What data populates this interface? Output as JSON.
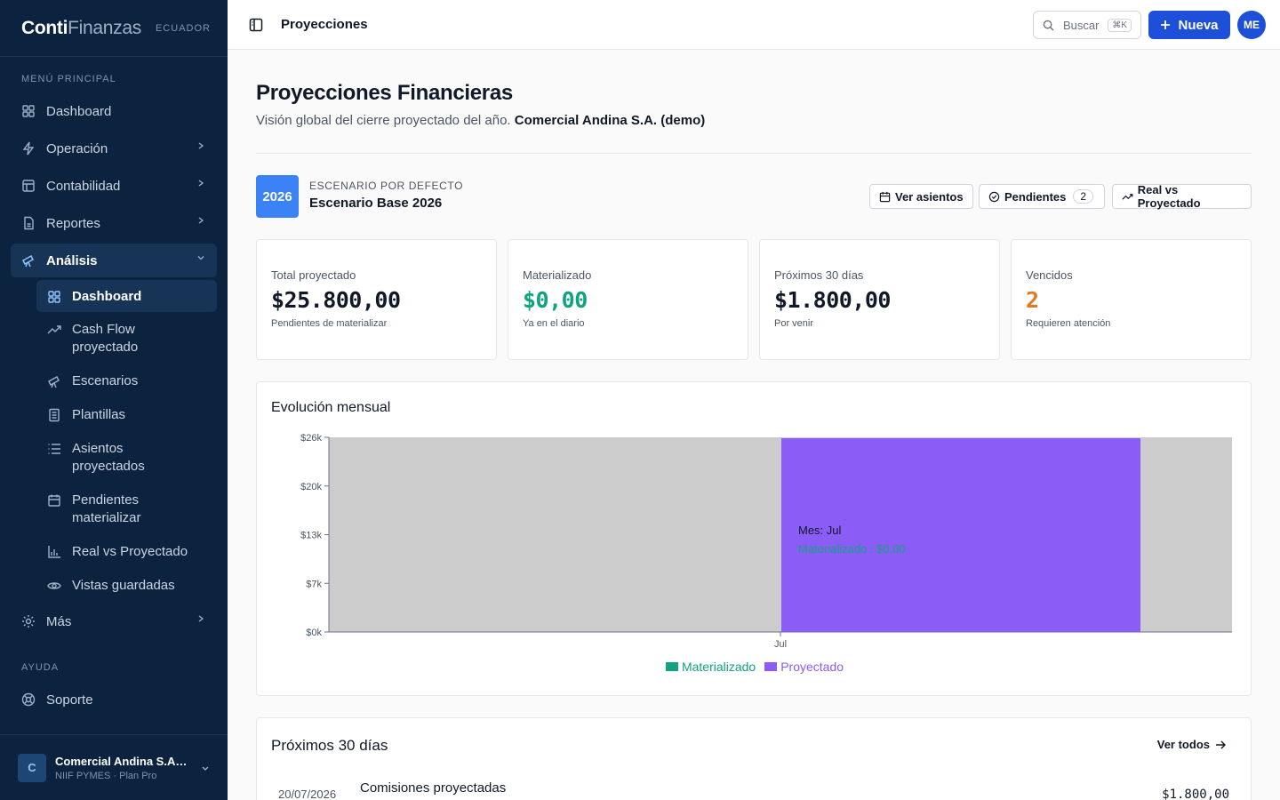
{
  "brand": {
    "name_a": "Conti",
    "name_b": "Finanzas",
    "country": "ECUADOR"
  },
  "sidebar": {
    "section_main": "MENÚ PRINCIPAL",
    "items": [
      {
        "label": "Dashboard",
        "icon": "grid-icon"
      },
      {
        "label": "Operación",
        "icon": "bolt-icon"
      },
      {
        "label": "Contabilidad",
        "icon": "grid-icon"
      },
      {
        "label": "Reportes",
        "icon": "file-icon"
      },
      {
        "label": "Análisis",
        "icon": "telescope-icon"
      }
    ],
    "sub_items": [
      {
        "label": "Dashboard"
      },
      {
        "label": "Cash Flow proyectado"
      },
      {
        "label": "Escenarios"
      },
      {
        "label": "Plantillas"
      },
      {
        "label": "Asientos proyectados"
      },
      {
        "label": "Pendientes materializar"
      },
      {
        "label": "Real vs Proyectado"
      },
      {
        "label": "Vistas guardadas"
      }
    ],
    "more": "Más",
    "section_help": "AYUDA",
    "support": "Soporte",
    "org_initial": "C",
    "org_name": "Comercial Andina S.A. (demo)",
    "org_plan": "NIIF PYMES · Plan Pro"
  },
  "header": {
    "title": "Proyecciones",
    "search_label": "Buscar",
    "search_kbd": "⌘K",
    "new_label": "Nueva",
    "user_initials": "ME"
  },
  "page": {
    "title": "Proyecciones Financieras",
    "subtitle": "Visión global del cierre proyectado del año.",
    "company": "Comercial Andina S.A. (demo)"
  },
  "scenario": {
    "year": "2026",
    "label": "ESCENARIO POR DEFECTO",
    "name": "Escenario Base 2026",
    "btn_entries": "Ver asientos",
    "btn_pending": "Pendientes",
    "pending_count": "2",
    "btn_real": "Real vs Proyectado"
  },
  "kpis": [
    {
      "label": "Total proyectado",
      "value": "$25.800,00",
      "note": "Pendientes de materializar"
    },
    {
      "label": "Materializado",
      "value": "$0,00",
      "note": "Ya en el diario"
    },
    {
      "label": "Próximos 30 días",
      "value": "$1.800,00",
      "note": "Por venir"
    },
    {
      "label": "Vencidos",
      "value": "2",
      "note": "Requieren atención"
    }
  ],
  "chart_card": {
    "title": "Evolución mensual"
  },
  "chart_data": {
    "type": "bar",
    "categories": [
      "Jul"
    ],
    "series": [
      {
        "name": "Materializado",
        "values": [
          0
        ],
        "color": "#10a37f"
      },
      {
        "name": "Proyectado",
        "values": [
          25800
        ],
        "color": "#8b5cf6"
      }
    ],
    "yticks": [
      "$0k",
      "$7k",
      "$13k",
      "$20k",
      "$26k"
    ],
    "ylim": [
      0,
      25800
    ],
    "legend": "bottom",
    "tooltip": {
      "title": "Mes: Jul",
      "line": "Materializado : $0,00"
    }
  },
  "upcoming": {
    "title": "Próximos 30 días",
    "link": "Ver todos",
    "rows": [
      {
        "date": "20/07/2026",
        "title": "Comisiones proyectadas",
        "amount": "$1.800,00"
      }
    ]
  }
}
